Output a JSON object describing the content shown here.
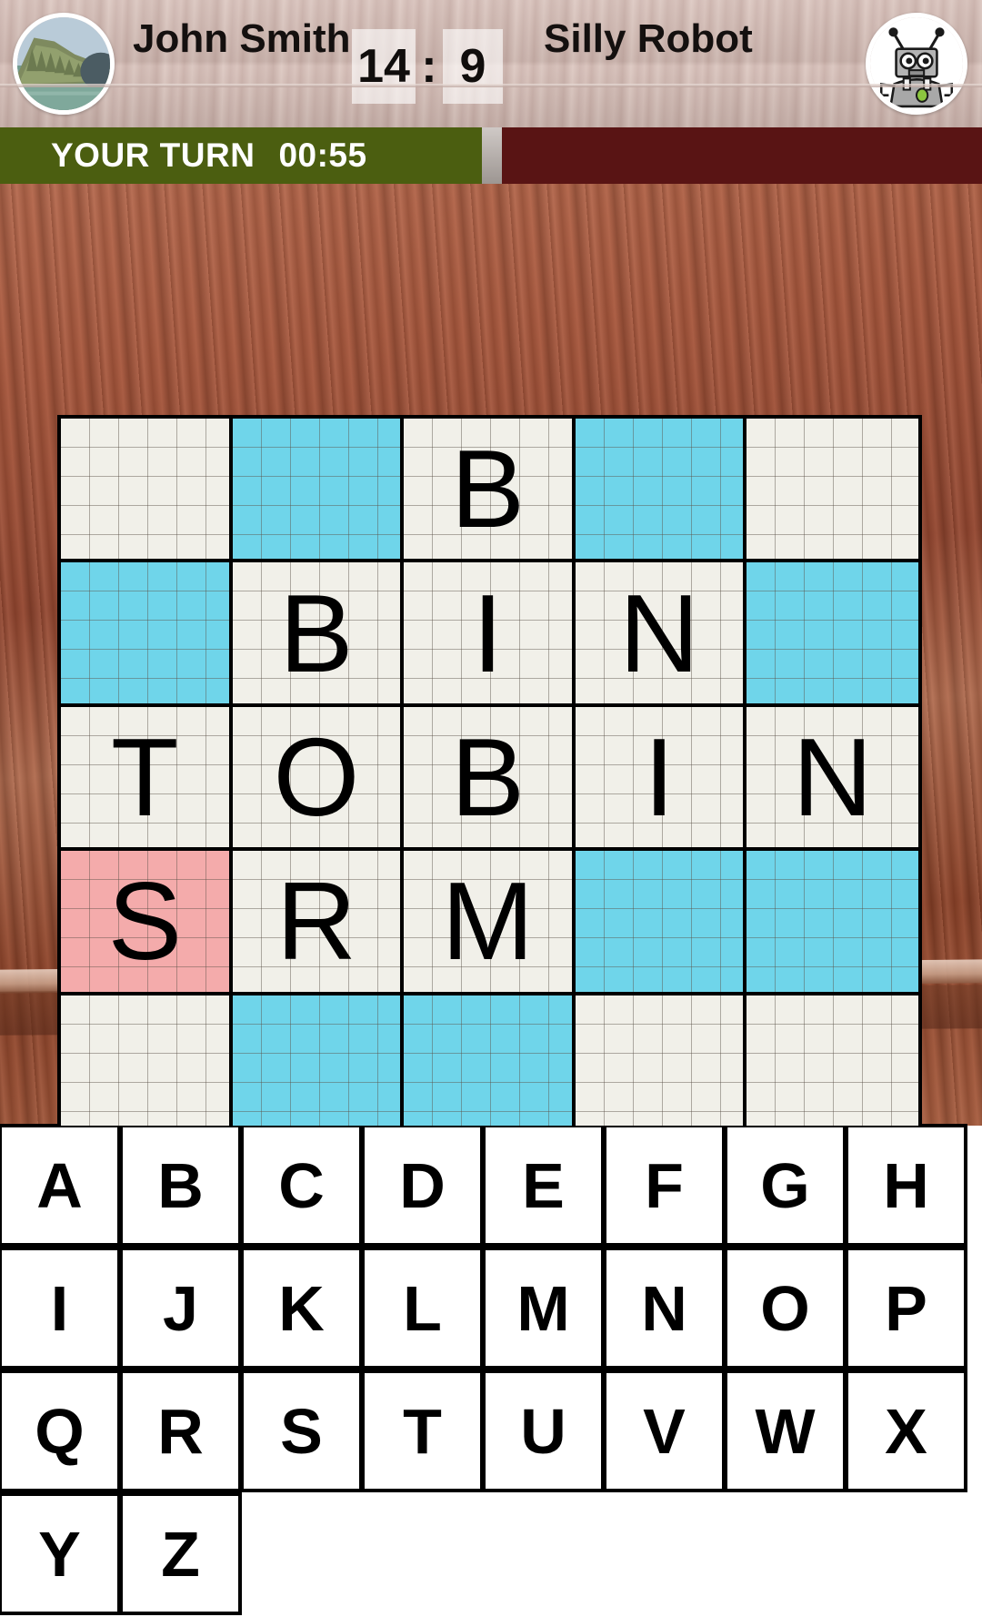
{
  "header": {
    "player_left": {
      "name": "John Smith",
      "avatar_icon": "building-photo-avatar"
    },
    "player_right": {
      "name": "Silly Robot",
      "avatar_icon": "robot-avatar"
    },
    "score": {
      "left": "14",
      "separator": ":",
      "right": "9"
    }
  },
  "turn_bar": {
    "status_label": "YOUR TURN",
    "timer": "00:55",
    "your_color": "#4b5e10",
    "opponent_color": "#591414"
  },
  "colors": {
    "cell_empty": "#f1f0e9",
    "cell_cyan": "#6fd5ea",
    "cell_pink": "#f4abab",
    "grid_line": "#000000",
    "board_wood": "#a8573c"
  },
  "board": {
    "rows": 5,
    "cols": 5,
    "cells": [
      {
        "letter": "",
        "state": "empty"
      },
      {
        "letter": "",
        "state": "cyan"
      },
      {
        "letter": "B",
        "state": "empty"
      },
      {
        "letter": "",
        "state": "cyan"
      },
      {
        "letter": "",
        "state": "empty"
      },
      {
        "letter": "",
        "state": "cyan"
      },
      {
        "letter": "B",
        "state": "empty"
      },
      {
        "letter": "I",
        "state": "empty"
      },
      {
        "letter": "N",
        "state": "empty"
      },
      {
        "letter": "",
        "state": "cyan"
      },
      {
        "letter": "T",
        "state": "empty"
      },
      {
        "letter": "O",
        "state": "empty"
      },
      {
        "letter": "B",
        "state": "empty"
      },
      {
        "letter": "I",
        "state": "empty"
      },
      {
        "letter": "N",
        "state": "empty"
      },
      {
        "letter": "S",
        "state": "pink"
      },
      {
        "letter": "R",
        "state": "empty"
      },
      {
        "letter": "M",
        "state": "empty"
      },
      {
        "letter": "",
        "state": "cyan"
      },
      {
        "letter": "",
        "state": "cyan"
      },
      {
        "letter": "",
        "state": "empty"
      },
      {
        "letter": "",
        "state": "cyan"
      },
      {
        "letter": "",
        "state": "cyan"
      },
      {
        "letter": "",
        "state": "empty"
      },
      {
        "letter": "",
        "state": "empty"
      }
    ]
  },
  "keyboard": {
    "rows": [
      [
        "A",
        "B",
        "C",
        "D",
        "E",
        "F",
        "G",
        "H"
      ],
      [
        "I",
        "J",
        "K",
        "L",
        "M",
        "N",
        "O",
        "P"
      ],
      [
        "Q",
        "R",
        "S",
        "T",
        "U",
        "V",
        "W",
        "X"
      ],
      [
        "Y",
        "Z"
      ]
    ]
  }
}
